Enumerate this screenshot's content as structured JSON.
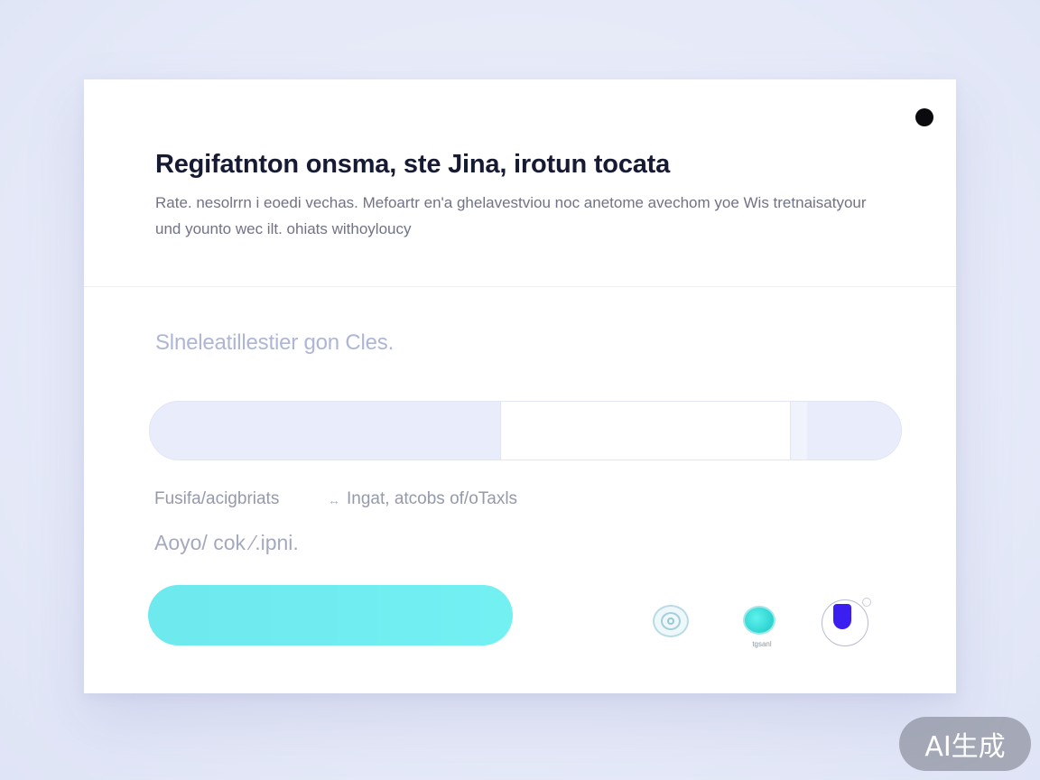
{
  "dialog": {
    "title": "Regifatnton onsma, ste Jina, irotun tocata",
    "description": "Rate. nesolrrn i eoedi vechas. Mefoartr en'a ghelavestviou noc anetome avechom yoe Wis tretnaisatyour und younto wec ilt. ohiats withoyloucy",
    "close_icon": "close-dot-icon"
  },
  "selector": {
    "label": "Slneleatillestier gon Cles.",
    "segments": [
      "",
      "",
      "",
      ""
    ]
  },
  "meta": {
    "left": "Fusifa/acigbriats",
    "separator": "↔",
    "right": "Ingat, atcobs of/oTaxls"
  },
  "sub_label": "Aoyo/ cok ⁄.ipni.",
  "actions": {
    "primary_label": "",
    "icons": [
      {
        "name": "fingerprint-icon"
      },
      {
        "name": "teal-circle-icon",
        "caption": "tgsanl"
      },
      {
        "name": "shield-toggle-icon"
      }
    ]
  },
  "watermark": "AI生成",
  "colors": {
    "accent_cyan": "#6ee9ee",
    "accent_indigo": "#3b1ef0",
    "title_text": "#161a33"
  }
}
